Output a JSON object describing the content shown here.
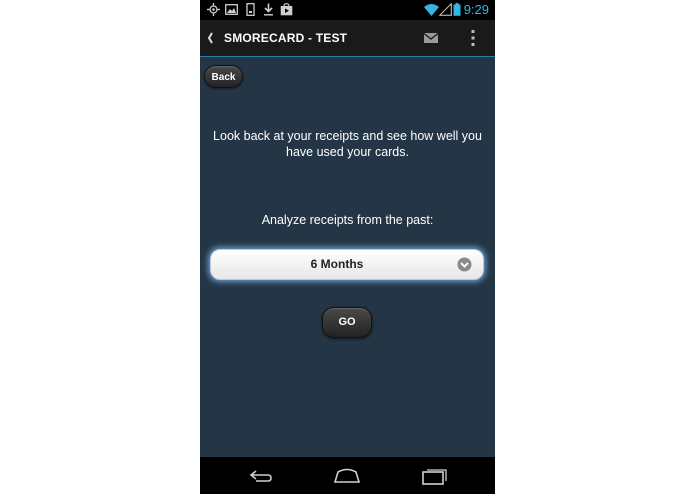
{
  "status_bar": {
    "time": "9:29",
    "icons": [
      "gps-icon",
      "image-icon",
      "sd-card-icon",
      "download-icon",
      "play-store-icon",
      "wifi-icon",
      "signal-icon",
      "battery-icon"
    ],
    "accent_color": "#33b5e5"
  },
  "action_bar": {
    "title": "SMORECARD - TEST",
    "icons": [
      "back-chevron-icon",
      "mail-icon",
      "overflow-menu-icon"
    ],
    "divider_color": "#2a7dab"
  },
  "content": {
    "back_label": "Back",
    "intro_text": "Look back at your receipts and see how well you have used your cards.",
    "analyze_label": "Analyze receipts from the past:",
    "period_select": {
      "selected": "6 Months"
    },
    "go_label": "GO",
    "background_color": "#243646"
  },
  "nav_bar": {
    "icons": [
      "nav-back-icon",
      "nav-home-icon",
      "nav-recents-icon"
    ]
  }
}
